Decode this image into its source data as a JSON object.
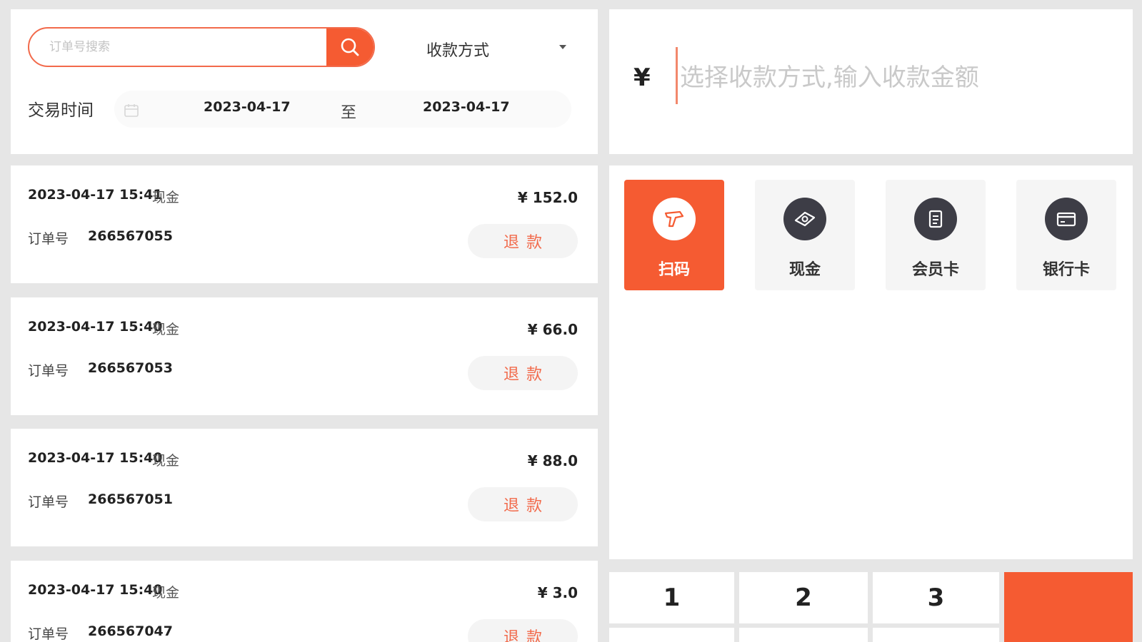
{
  "search": {
    "placeholder": "订单号搜索"
  },
  "filter": {
    "payment_method_label": "收款方式",
    "time_label": "交易时间",
    "date_start": "2023-04-17",
    "date_separator": "至",
    "date_end": "2023-04-17"
  },
  "transactions": [
    {
      "time": "2023-04-17 15:41",
      "method": "现金",
      "order_label": "订单号",
      "order_no": "266567055",
      "amount": "¥ 152.0",
      "refund_label": "退款"
    },
    {
      "time": "2023-04-17 15:40",
      "method": "现金",
      "order_label": "订单号",
      "order_no": "266567053",
      "amount": "¥ 66.0",
      "refund_label": "退款"
    },
    {
      "time": "2023-04-17 15:40",
      "method": "现金",
      "order_label": "订单号",
      "order_no": "266567051",
      "amount": "¥ 88.0",
      "refund_label": "退款"
    },
    {
      "time": "2023-04-17 15:40",
      "method": "现金",
      "order_label": "订单号",
      "order_no": "266567047",
      "amount": "¥ 3.0",
      "refund_label": "退款"
    }
  ],
  "amount": {
    "currency": "¥",
    "placeholder": "选择收款方式,输入收款金额"
  },
  "payment_methods": [
    {
      "label": "扫码",
      "icon": "scanner-icon",
      "active": true
    },
    {
      "label": "现金",
      "icon": "cash-icon",
      "active": false
    },
    {
      "label": "会员卡",
      "icon": "member-card-icon",
      "active": false
    },
    {
      "label": "银行卡",
      "icon": "bank-card-icon",
      "active": false
    }
  ],
  "keypad": {
    "keys": [
      "1",
      "2",
      "3"
    ]
  },
  "colors": {
    "accent": "#f55b32",
    "background": "#e6e6e6",
    "icon_dark": "#3d3d46"
  }
}
